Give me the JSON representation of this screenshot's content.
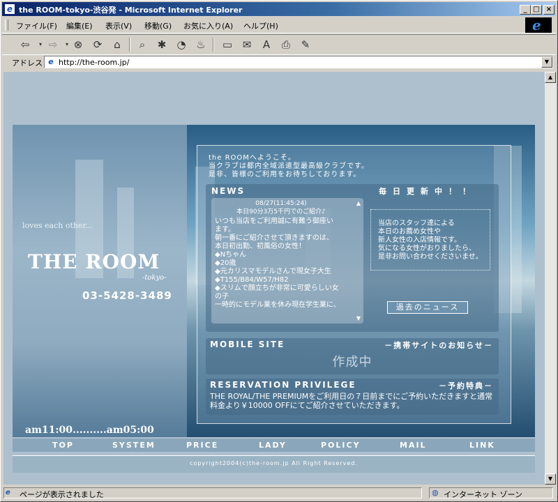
{
  "window": {
    "title": "the ROOM-tokyo-渋谷発 - Microsoft Internet Explorer"
  },
  "menu": {
    "items": [
      "ファイル(F)",
      "編集(E)",
      "表示(V)",
      "移動(G)",
      "お気に入り(A)",
      "ヘルプ(H)"
    ]
  },
  "address": {
    "label": "アドレス",
    "url": "http://the-room.jp/"
  },
  "site": {
    "tagline": "loves each other...",
    "logo": "THE ROOM",
    "logo_sub": "-tokyo-",
    "phone": "03-5428-3489",
    "hours": "am11:00..........am05:00",
    "welcome": [
      "the ROOMへようこそ。",
      "当クラブは都内全域派遣型最高級クラブです。",
      "是非、皆様のご利用をお待ちしております。"
    ],
    "news": {
      "title": "NEWS",
      "status": "毎日更新中！！",
      "date": "08/27(11:45:24)",
      "headline": "本日90分3万5千円でのご紹介♪",
      "body": [
        "いつも当店をご利用誠に有難う御座い",
        "ます。",
        "朝一番にご紹介させて頂きますのは、",
        "本日初出勤、初風俗の女性！",
        "◆Nちゃん",
        "◆20歳",
        "◆元カリスマモデルさんで現女子大生",
        "◆T155/B84/W57/H82",
        "◆スリムで顔立ちが非常に可愛らしい女",
        "の子",
        "一時的にモデル業を休み現在学生業に、"
      ],
      "staff": [
        "当店のスタッフ達による",
        "本日のお薦め女性や",
        "新人女性の入店情報です。",
        "気になる女性がおりましたら、",
        "是非お問い合わせくださいませ。"
      ],
      "past_button": "過去のニュース"
    },
    "mobile": {
      "title": "MOBILE SITE",
      "subtitle": "－携帯サイトのお知らせ－",
      "text": "作成中"
    },
    "reservation": {
      "title": "RESERVATION PRIVILEGE",
      "subtitle": "－予約特典－",
      "text": "THE ROYAL/THE PREMIUMをご利用日の７日前までにご予約いただきますと通常料金より￥10000 OFFにてご紹介させていただきます。"
    },
    "nav": [
      "TOP",
      "SYSTEM",
      "PRICE",
      "LADY",
      "POLICY",
      "MAIL",
      "LINK"
    ],
    "copyright": "copyright2004(c)the-room.jp All Right Reserved."
  },
  "status": {
    "text": "ページが表示されました",
    "zone": "インターネット ゾーン"
  }
}
